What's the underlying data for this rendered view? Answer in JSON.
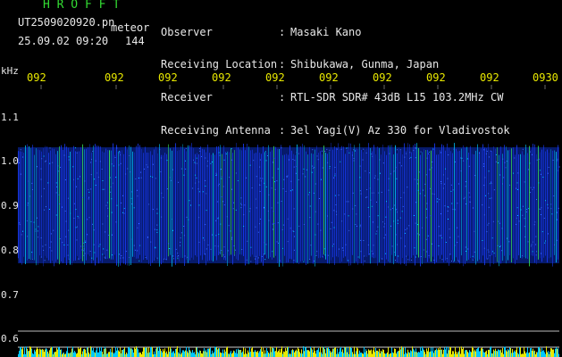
{
  "header": {
    "brand": "H R O F F T",
    "file_name": "UT2509020920.pn",
    "mode": "meteor",
    "datetime": "25.09.02 09:20",
    "count": "144"
  },
  "info": {
    "labels": [
      "Observer",
      "Receiving Location",
      "Receiver",
      "Receiving Antenna"
    ],
    "colons": [
      ":",
      ":",
      ":",
      ":"
    ],
    "values": [
      "Masaki Kano",
      "Shibukawa, Gunma, Japan",
      "RTL-SDR SDR# 43dB L15 103.2MHz CW",
      "3el Yagi(V) Az 330 for Vladivostok"
    ]
  },
  "axis": {
    "unit": "kHz",
    "x_ticks": [
      "092",
      "092",
      "092",
      "092",
      "092",
      "092",
      "092",
      "092",
      "092",
      "0930"
    ],
    "y_ticks": [
      "1.1",
      "1.0",
      "0.9",
      "0.8",
      "0.7",
      "0.6"
    ]
  },
  "colors": {
    "background": "#000000",
    "header_green": "#33dd33",
    "text_white": "#e8e8e8",
    "tick_yellow": "#e8e800",
    "signal_blue": "#1a3cff",
    "signal_cyan": "#00c8ff",
    "signal_green": "#40ff60"
  }
}
